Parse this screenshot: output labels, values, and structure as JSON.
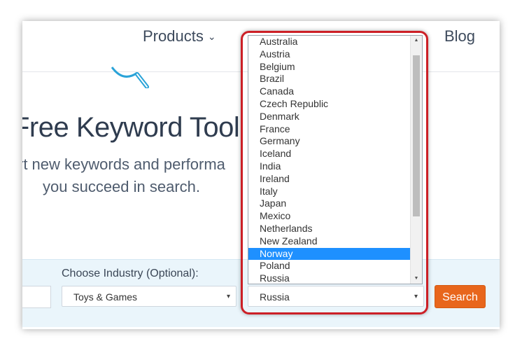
{
  "nav": {
    "products": "Products",
    "products_chevron": "⌄",
    "blog": "Blog"
  },
  "hero": {
    "title": "Free Keyword Tool",
    "subtitle_line1": "rt new keywords and performa",
    "subtitle_line2": "you succeed in search."
  },
  "filters": {
    "industry_label": "Choose Industry (Optional):",
    "industry_value": "Toys & Games",
    "country_value": "Russia",
    "search_label": "Search"
  },
  "country_dropdown": {
    "options": [
      "Australia",
      "Austria",
      "Belgium",
      "Brazil",
      "Canada",
      "Czech Republic",
      "Denmark",
      "France",
      "Germany",
      "Iceland",
      "India",
      "Ireland",
      "Italy",
      "Japan",
      "Mexico",
      "Netherlands",
      "New Zealand",
      "Norway",
      "Poland",
      "Russia"
    ],
    "highlighted": "Norway"
  },
  "colors": {
    "accent": "#e8661c",
    "highlight_border": "#cc1f26",
    "selection": "#1e90ff",
    "band": "#eaf5fb"
  },
  "icons": {
    "caret": "▾",
    "scroll_up": "▲",
    "scroll_down": "▼",
    "hero_icon": "magnifier-icon"
  }
}
